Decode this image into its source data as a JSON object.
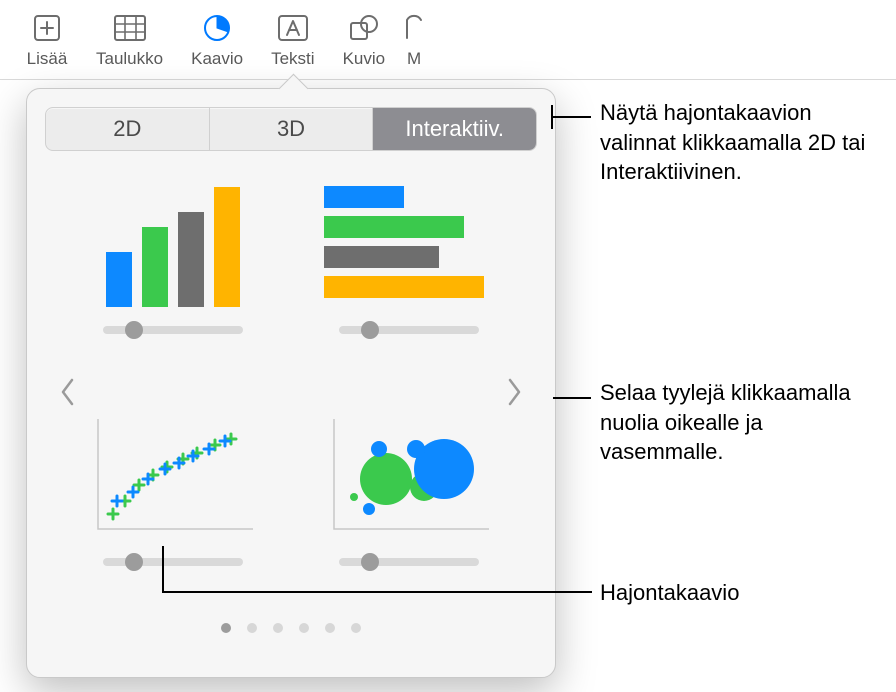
{
  "toolbar": {
    "items": [
      {
        "label": "Lisää"
      },
      {
        "label": "Taulukko"
      },
      {
        "label": "Kaavio"
      },
      {
        "label": "Teksti"
      },
      {
        "label": "Kuvio"
      },
      {
        "label": "M"
      }
    ]
  },
  "popover": {
    "tabs": {
      "tab_2d": "2D",
      "tab_3d": "3D",
      "tab_interactive": "Interaktiiv.",
      "selected": "Interaktiiv."
    },
    "page_count": 6,
    "active_page": 0,
    "previews": [
      {
        "name": "column-chart"
      },
      {
        "name": "bar-chart"
      },
      {
        "name": "scatter-chart"
      },
      {
        "name": "bubble-chart"
      }
    ],
    "palette": {
      "c1": "#0d89ff",
      "c2": "#3bc94d",
      "c3": "#6e6e6e",
      "c4": "#ffb400"
    }
  },
  "callouts": {
    "tabs_hint": "Näytä hajontakaavion valinnat klikkaamalla 2D tai Interaktiivinen.",
    "arrows_hint": "Selaa tyylejä klikkaamalla nuolia oikealle ja vasemmalle.",
    "scatter_label": "Hajontakaavio"
  }
}
